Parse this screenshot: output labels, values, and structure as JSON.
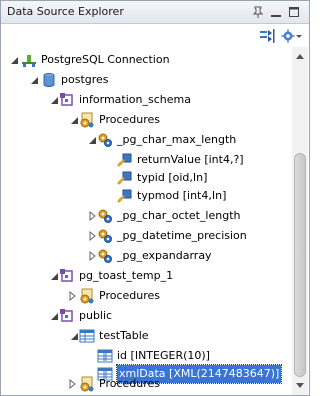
{
  "window": {
    "title": "Data Source Explorer"
  },
  "tree": {
    "connection": "PostgreSQL Connection",
    "database": "postgres",
    "info_schema": "information_schema",
    "procedures_1": "Procedures",
    "proc_max_length": "_pg_char_max_length",
    "param_returnValue": "returnValue [int4,?]",
    "param_typid": "typid [oid,In]",
    "param_typmod": "typmod [int4,In]",
    "proc_octet_length": "_pg_char_octet_length",
    "proc_datetime_precision": "_pg_datetime_precision",
    "proc_expandarray": "_pg_expandarray",
    "toast_schema": "pg_toast_temp_1",
    "procedures_2": "Procedures",
    "public_schema": "public",
    "test_table": "testTable",
    "col_id": "id [INTEGER(10)]",
    "col_xmldata": "xmlData [XML(2147483647)]",
    "procedures_3": "Procedures"
  },
  "colors": {
    "selection": "#3875d7",
    "schema_icon": "#7a4fb0",
    "procedure_icon": "#e0a020",
    "table_icon": "#3b78c2"
  }
}
